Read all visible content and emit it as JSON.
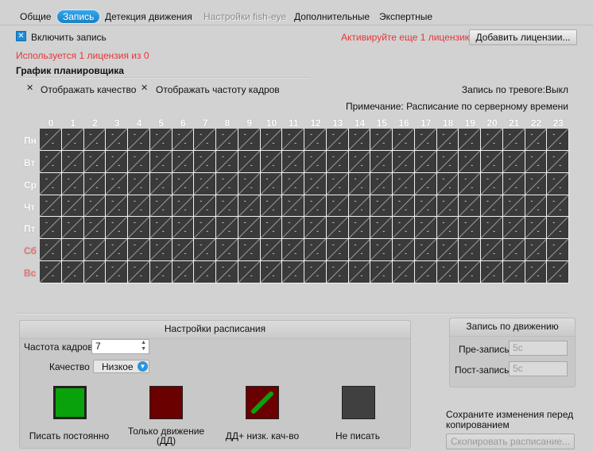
{
  "tabs": [
    {
      "label": "Общие",
      "state": "normal"
    },
    {
      "label": "Запись",
      "state": "active"
    },
    {
      "label": "Детекция движения",
      "state": "normal"
    },
    {
      "label": "Настройки fish-eye",
      "state": "disabled"
    },
    {
      "label": "Дополнительные",
      "state": "normal"
    },
    {
      "label": "Экспертные",
      "state": "normal"
    }
  ],
  "enable_recording": {
    "label": "Включить запись",
    "checked": true
  },
  "license": {
    "activate_text": "Активируйте еще 1 лицензию",
    "add_button": "Добавить лицензии...",
    "used_text": "Используется 1 лицензия из 0"
  },
  "scheduler": {
    "title": "График планировщика",
    "show_quality": "Отображать качество",
    "show_fps": "Отображать частоту кадров",
    "alarm_recording": "Запись по тревоге:Выкл",
    "note": "Примечание: Расписание по серверному времени",
    "hours": [
      "0",
      "1",
      "2",
      "3",
      "4",
      "5",
      "6",
      "7",
      "8",
      "9",
      "10",
      "11",
      "12",
      "13",
      "14",
      "15",
      "16",
      "17",
      "18",
      "19",
      "20",
      "21",
      "22",
      "23"
    ],
    "days": [
      "Пн",
      "Вт",
      "Ср",
      "Чт",
      "Пт",
      "Сб",
      "Вс"
    ],
    "cell_text": "-",
    "cell_color": "#3a3a3a"
  },
  "schedule_settings": {
    "title": "Настройки расписания",
    "fps_label": "Частота кадров",
    "fps_value": "7",
    "quality_label": "Качество",
    "quality_value": "Низкое",
    "modes": [
      {
        "label": "Писать постоянно",
        "color": "#0aa20a"
      },
      {
        "label": "Только движение (ДД)",
        "color": "#6a0000"
      },
      {
        "label": "ДД+ низк. кач-во",
        "color": "#6a0000",
        "stripe": "#0aa20a"
      },
      {
        "label": "Не писать",
        "color": "#404040"
      }
    ]
  },
  "motion_recording": {
    "title": "Запись по движению",
    "pre_label": "Пре-запись",
    "pre_value": "5с",
    "post_label": "Пост-запись",
    "post_value": "5с"
  },
  "copy": {
    "hint": "Сохраните изменения перед копированием",
    "button": "Скопировать расписание..."
  },
  "colors": {
    "accent": "#1a7fc4",
    "warning": "#e8353a",
    "weekend": "#f07a7a"
  }
}
